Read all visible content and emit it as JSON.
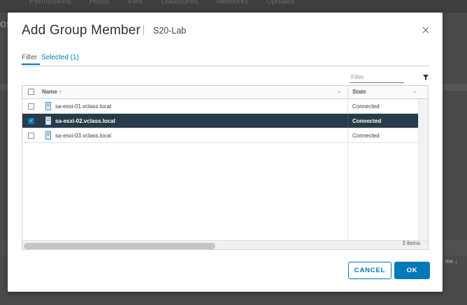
{
  "background": {
    "tabs": [
      "Permissions",
      "Hosts",
      "VMs",
      "Datastores",
      "Networks",
      "Updates"
    ],
    "fragment_left": "os",
    "fragment_right": "me ↓"
  },
  "dialog": {
    "title": "Add Group Member",
    "subtitle": "S20-Lab",
    "close_icon": "close-icon",
    "tabs": [
      {
        "label": "Filter",
        "active": true
      },
      {
        "label": "Selected (1)",
        "active": false
      }
    ],
    "filter_placeholder": "Filter",
    "grid": {
      "columns": [
        {
          "label": "Name",
          "sort": "ascending"
        },
        {
          "label": "State"
        }
      ],
      "sort_icon": "↑",
      "dropdown_icon": "⌄",
      "rows": [
        {
          "name": "sa-esxi-01.vclass.local",
          "state": "Connected",
          "checked": false,
          "selected": false
        },
        {
          "name": "sa-esxi-02.vclass.local",
          "state": "Connected",
          "checked": true,
          "selected": true
        },
        {
          "name": "sa-esxi-03.vclass.local",
          "state": "Connected",
          "checked": false,
          "selected": false
        }
      ],
      "item_count": "3 items"
    },
    "buttons": {
      "cancel": "CANCEL",
      "ok": "OK"
    },
    "colors": {
      "accent": "#0079b8",
      "selected_row": "#283b48"
    }
  }
}
